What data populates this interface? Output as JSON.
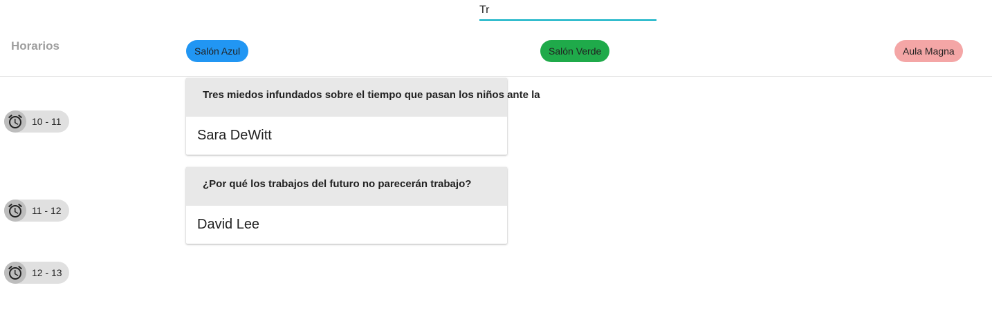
{
  "search": {
    "value": "Tr",
    "placeholder": ""
  },
  "header": {
    "schedule_title": "Horarios",
    "rooms": [
      {
        "label": "Salón Azul",
        "color": "#2196f3",
        "text_color": "#1a1a1a"
      },
      {
        "label": "Salón Verde",
        "color": "#1faa4a",
        "text_color": "#1a1a1a"
      },
      {
        "label": "Aula Magna",
        "color": "#f4a6a6",
        "text_color": "#1a1a1a"
      }
    ]
  },
  "time_slots": [
    {
      "label": "10 - 11",
      "icon": "alarm-clock-icon"
    },
    {
      "label": "11 - 12",
      "icon": "alarm-clock-icon"
    },
    {
      "label": "12 - 13",
      "icon": "alarm-clock-icon"
    }
  ],
  "talks": [
    {
      "title": "Tres miedos infundados sobre el tiempo que pasan los niños ante la",
      "speaker": "Sara DeWitt",
      "room": "Salón Azul",
      "slot": "10 - 11"
    },
    {
      "title": "¿Por qué los trabajos del futuro no parecerán trabajo?",
      "speaker": "David Lee",
      "room": "Salón Azul",
      "slot": "11 - 12"
    }
  ],
  "colors": {
    "accent": "#00acc1",
    "card_header": "#e8e8e8",
    "chip": "#e0e0e0",
    "muted_title": "#9e9e9e"
  }
}
